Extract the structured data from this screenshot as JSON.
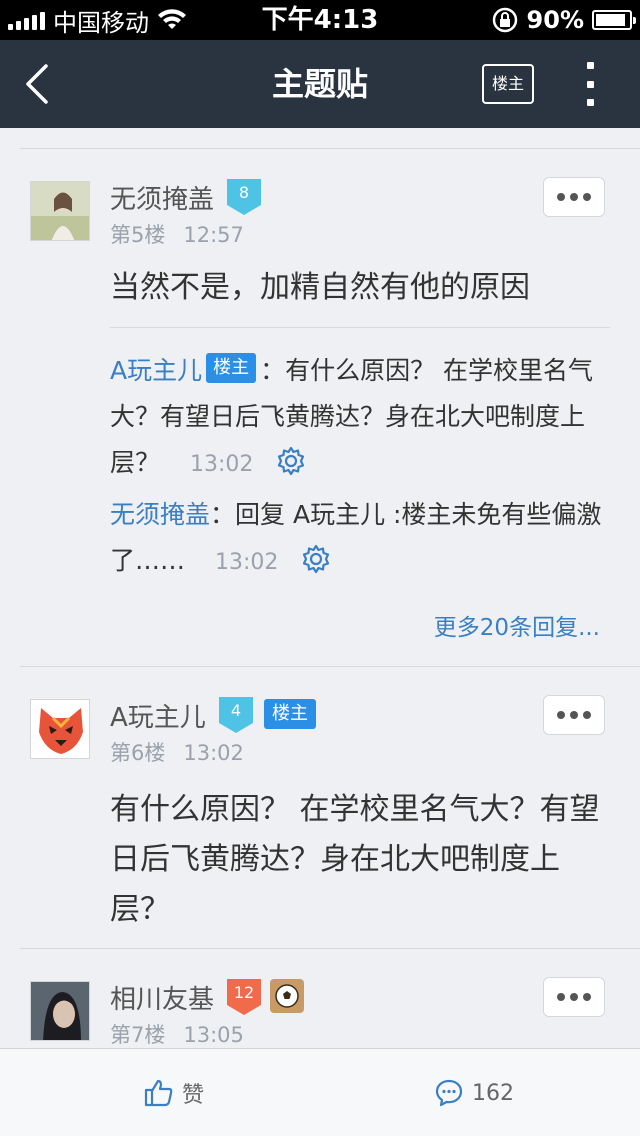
{
  "status_bar": {
    "carrier": "中国移动",
    "time": "下午4:13",
    "battery": "90%",
    "battery_level": 0.9
  },
  "nav": {
    "title": "主题贴",
    "owner_only_label": "楼主"
  },
  "colors": {
    "navbar": "#2a3340",
    "link": "#3a7fc4",
    "owner_tag": "#2b8fe6",
    "level_blue": "#4fc3e6",
    "level_red": "#ef6b4a"
  },
  "posts": [
    {
      "author": "无须掩盖",
      "level": "8",
      "floor": "第5楼",
      "time": "12:57",
      "content": "当然不是，加精自然有他的原因",
      "replies": [
        {
          "author": "A玩主儿",
          "tag": "楼主",
          "text": "：有什么原因？ 在学校里名气大？有望日后飞黄腾达？身在北大吧制度上层？",
          "time": "13:02"
        },
        {
          "author": "无须掩盖",
          "text": "：回复 A玩主儿 :楼主未免有些偏激了……",
          "time": "13:02"
        }
      ],
      "more_replies": "更多20条回复..."
    },
    {
      "author": "A玩主儿",
      "level": "4",
      "tag": "楼主",
      "floor": "第6楼",
      "time": "13:02",
      "content": "有什么原因？ 在学校里名气大？有望日后飞黄腾达？身在北大吧制度上层？"
    },
    {
      "author": "相川友基",
      "level": "12",
      "floor": "第7楼",
      "time": "13:05"
    }
  ],
  "bottom_bar": {
    "like_label": "赞",
    "comment_count": "162"
  }
}
